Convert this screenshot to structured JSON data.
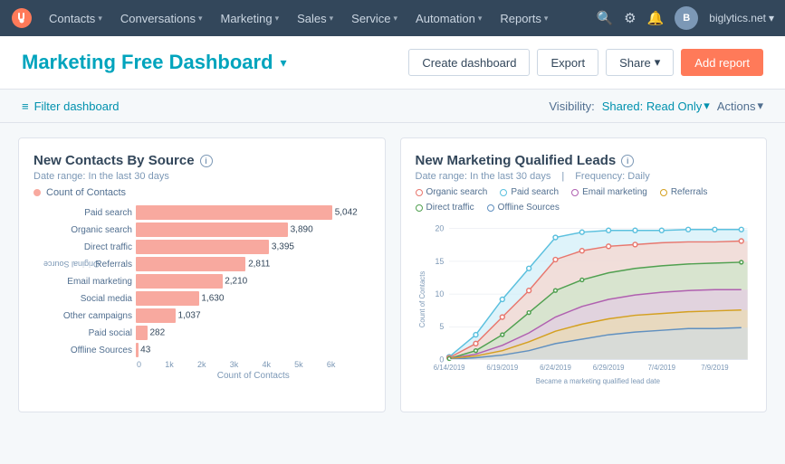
{
  "navbar": {
    "logo_alt": "HubSpot",
    "items": [
      {
        "label": "Contacts",
        "id": "contacts"
      },
      {
        "label": "Conversations",
        "id": "conversations"
      },
      {
        "label": "Marketing",
        "id": "marketing"
      },
      {
        "label": "Sales",
        "id": "sales"
      },
      {
        "label": "Service",
        "id": "service"
      },
      {
        "label": "Automation",
        "id": "automation"
      },
      {
        "label": "Reports",
        "id": "reports"
      }
    ],
    "account": "biglytics.net"
  },
  "header": {
    "title": "Marketing Free Dashboard",
    "buttons": {
      "create": "Create dashboard",
      "export": "Export",
      "share": "Share",
      "add_report": "Add report"
    }
  },
  "filter_bar": {
    "filter_label": "Filter dashboard",
    "visibility_prefix": "Visibility:",
    "visibility_value": "Shared: Read Only",
    "actions_label": "Actions"
  },
  "chart1": {
    "title": "New Contacts By Source",
    "date_range": "Date range: In the last 30 days",
    "legend_label": "Count of Contacts",
    "legend_color": "#f8a99f",
    "y_axis_label": "Original Source",
    "x_axis_label": "Count of Contacts",
    "x_axis_ticks": [
      "0",
      "1k",
      "2k",
      "3k",
      "4k",
      "5k",
      "6k"
    ],
    "bars": [
      {
        "label": "Paid search",
        "value": 5042,
        "display": "5,042",
        "pct": 84
      },
      {
        "label": "Organic search",
        "value": 3890,
        "display": "3,890",
        "pct": 65
      },
      {
        "label": "Direct traffic",
        "value": 3395,
        "display": "3,395",
        "pct": 57
      },
      {
        "label": "Referrals",
        "value": 2811,
        "display": "2,811",
        "pct": 47
      },
      {
        "label": "Email marketing",
        "value": 2210,
        "display": "2,210",
        "pct": 37
      },
      {
        "label": "Social media",
        "value": 1630,
        "display": "1,630",
        "pct": 27
      },
      {
        "label": "Other campaigns",
        "value": 1037,
        "display": "1,037",
        "pct": 17
      },
      {
        "label": "Paid social",
        "value": 282,
        "display": "282",
        "pct": 5
      },
      {
        "label": "Offline Sources",
        "value": 43,
        "display": "43",
        "pct": 1
      }
    ]
  },
  "chart2": {
    "title": "New Marketing Qualified Leads",
    "date_range": "Date range: In the last 30 days",
    "frequency": "Frequency: Daily",
    "y_axis_label": "Count of Contacts",
    "x_axis_label": "Became a marketing qualified lead date",
    "y_ticks": [
      "0",
      "5",
      "10",
      "15",
      "20"
    ],
    "x_ticks": [
      "6/14/2019",
      "6/19/2019",
      "6/24/2019",
      "6/29/2019",
      "7/4/2019",
      "7/9/2019"
    ],
    "legend": [
      {
        "label": "Organic search",
        "color": "#f1a0a0",
        "border": "#e8776e"
      },
      {
        "label": "Paid search",
        "color": "#5bc0de",
        "border": "#5bc0de"
      },
      {
        "label": "Email marketing",
        "color": "#d4a0d4",
        "border": "#b060b0"
      },
      {
        "label": "Referrals",
        "color": "#f0c040",
        "border": "#d4a020"
      },
      {
        "label": "Direct traffic",
        "color": "#90d090",
        "border": "#50a050"
      },
      {
        "label": "Offline Sources",
        "color": "#a0c4e8",
        "border": "#6090c0"
      }
    ]
  }
}
